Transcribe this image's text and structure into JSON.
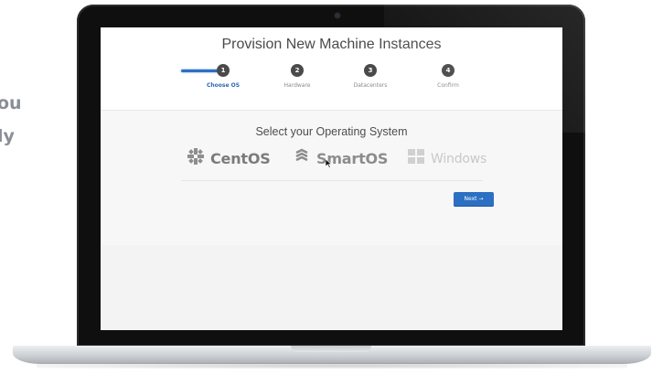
{
  "side_text": {
    "line1": "ou",
    "line2": "ly"
  },
  "app": {
    "title": "Provision New Machine Instances",
    "steps": [
      {
        "number": "1",
        "label": "Choose OS"
      },
      {
        "number": "2",
        "label": "Hardware"
      },
      {
        "number": "3",
        "label": "Datacenters"
      },
      {
        "number": "4",
        "label": "Confirm"
      }
    ],
    "active_step": 1,
    "section_title": "Select your Operating System",
    "os_options": [
      {
        "name": "CentOS",
        "icon": "centos-icon"
      },
      {
        "name": "SmartOS",
        "icon": "smartos-icon"
      },
      {
        "name": "Windows",
        "icon": "windows-icon"
      }
    ],
    "next_button": "Next →"
  },
  "colors": {
    "accent": "#2c6fc3",
    "step_circle": "#4a4a4a",
    "bezel": "#0f0f10"
  }
}
